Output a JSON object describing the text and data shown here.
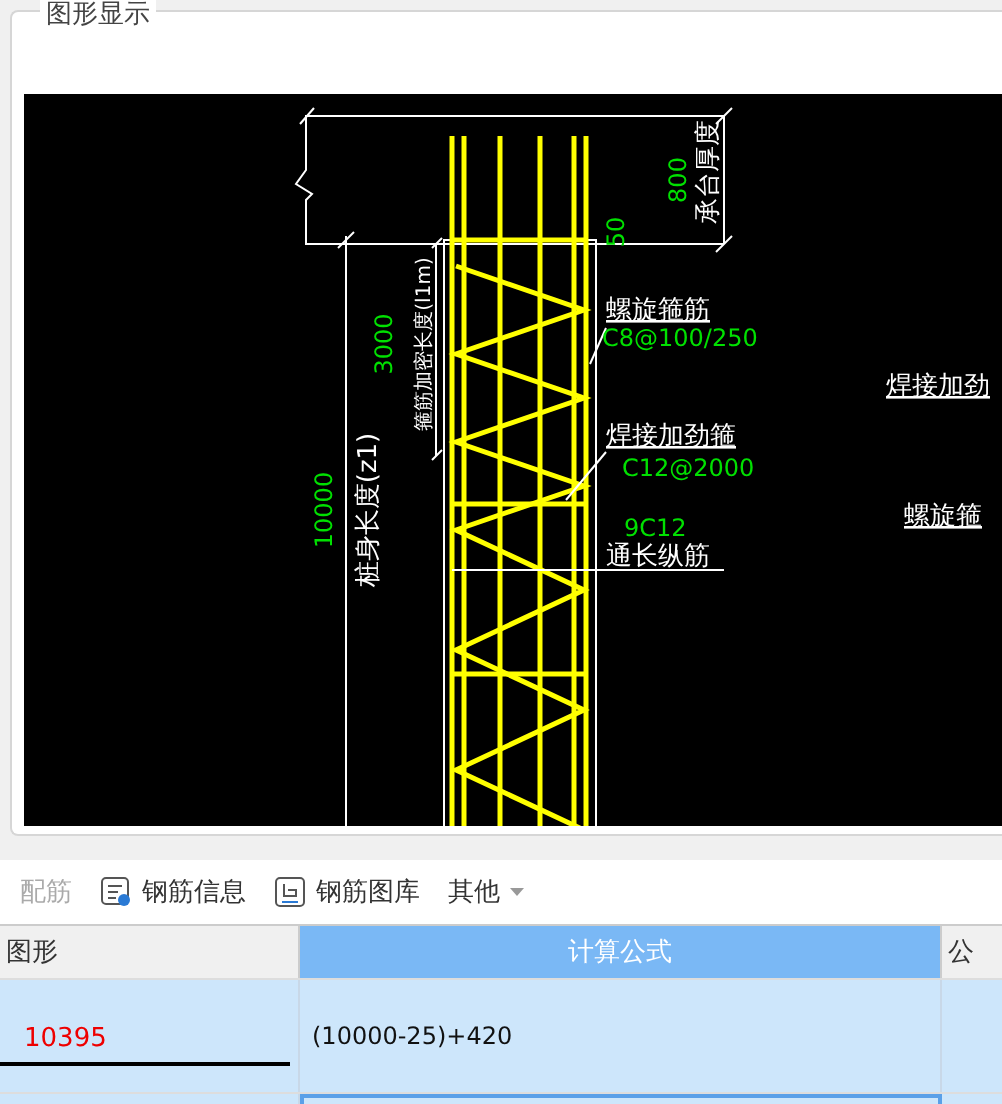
{
  "group_title": "图形显示",
  "drawing": {
    "labels": [
      {
        "text": "承台厚度",
        "kind": "label"
      },
      {
        "text": "800",
        "kind": "dimension"
      },
      {
        "text": "50",
        "kind": "dimension"
      },
      {
        "text": "箍筋加密长度(l1m)",
        "kind": "label"
      },
      {
        "text": "3000",
        "kind": "dimension"
      },
      {
        "text": "桩身长度(z1)",
        "kind": "label"
      },
      {
        "text": "10000",
        "kind": "dimension"
      },
      {
        "text": "螺旋箍筋",
        "kind": "label"
      },
      {
        "text": "C8@100/250",
        "kind": "dimension"
      },
      {
        "text": "焊接加劲箍",
        "kind": "label"
      },
      {
        "text": "C12@2000",
        "kind": "dimension"
      },
      {
        "text": "9C12",
        "kind": "dimension"
      },
      {
        "text": "通长纵筋",
        "kind": "label"
      },
      {
        "text": "焊接加劲",
        "kind": "label"
      },
      {
        "text": "螺旋箍",
        "kind": "label"
      }
    ]
  },
  "toolbar": [
    {
      "label": "配筋",
      "kind": "plain",
      "disabled": true
    },
    {
      "label": "钢筋信息",
      "kind": "info",
      "disabled": false
    },
    {
      "label": "钢筋图库",
      "kind": "library",
      "disabled": false
    },
    {
      "label": "其他",
      "kind": "dropdown",
      "disabled": false
    }
  ],
  "table": {
    "columns": [
      {
        "label": "图形",
        "selected": false
      },
      {
        "label": "计算公式",
        "selected": true
      },
      {
        "label": "公",
        "selected": false
      }
    ],
    "rows": [
      {
        "figure": "10395",
        "formula": "(10000-25)+420"
      }
    ]
  }
}
